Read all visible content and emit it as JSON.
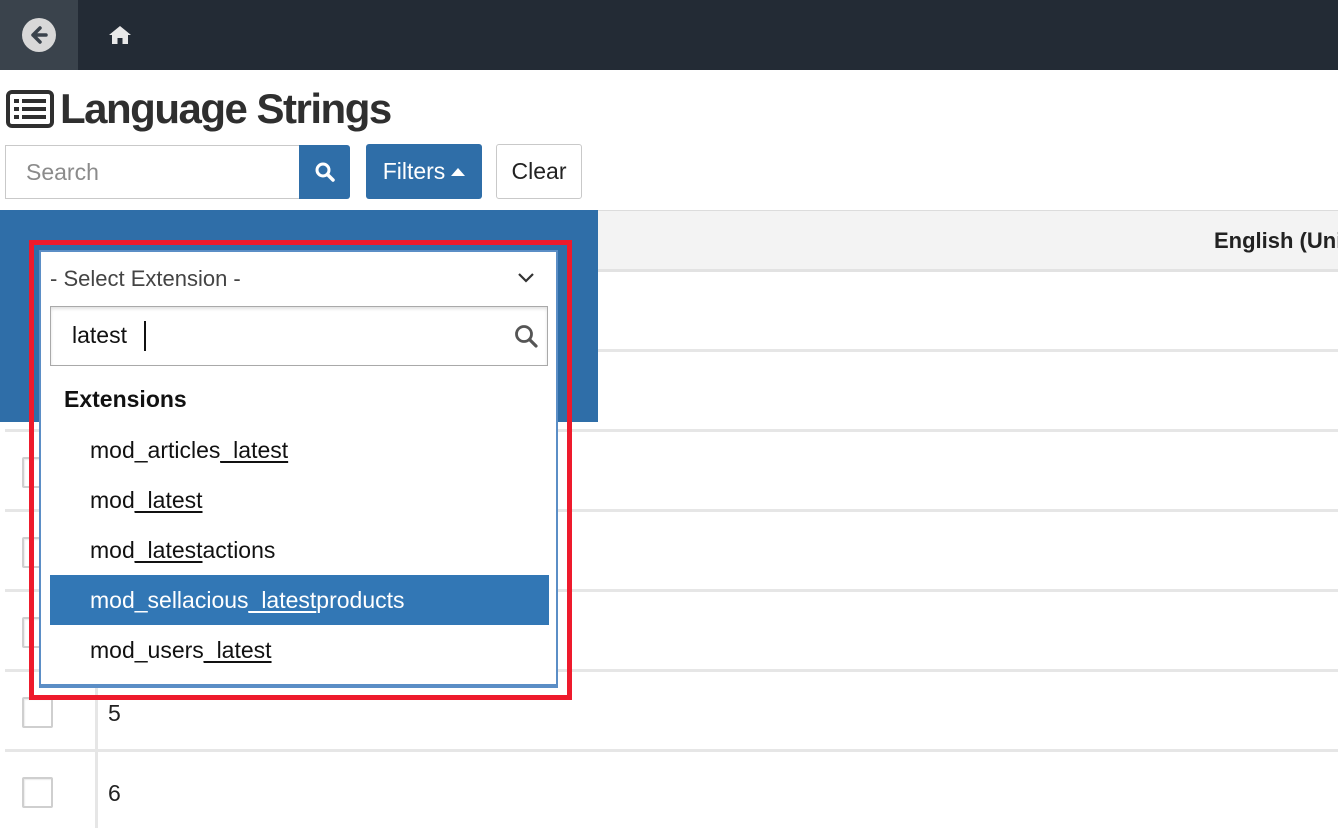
{
  "topbar": {
    "back_icon": "arrow-left-circle-icon",
    "home_icon": "home-icon"
  },
  "page": {
    "title": "Language Strings",
    "title_icon": "list-icon"
  },
  "toolbar": {
    "search_placeholder": "Search",
    "search_icon": "search-icon",
    "filters_label": "Filters",
    "clear_label": "Clear"
  },
  "table": {
    "column_language": "English (Uni",
    "rows": [
      {
        "id": "5"
      },
      {
        "id": "6"
      }
    ]
  },
  "extension_select": {
    "placeholder": "- Select Extension -",
    "search_value": "latest",
    "group_label": "Extensions",
    "options": [
      {
        "before": "mod_articles",
        "match": "_latest",
        "after": "",
        "selected": false
      },
      {
        "before": "mod",
        "match": "_latest",
        "after": "",
        "selected": false
      },
      {
        "before": "mod",
        "match": "_latest",
        "after": "actions",
        "selected": false
      },
      {
        "before": "mod_sellacious",
        "match": "_latest",
        "after": "products",
        "selected": true
      },
      {
        "before": "mod_users",
        "match": "_latest",
        "after": "",
        "selected": false
      }
    ]
  },
  "colors": {
    "topbar": "#232b35",
    "primary": "#2f6ea8",
    "highlight": "#3277b5",
    "annotation": "#ee1a2c"
  }
}
